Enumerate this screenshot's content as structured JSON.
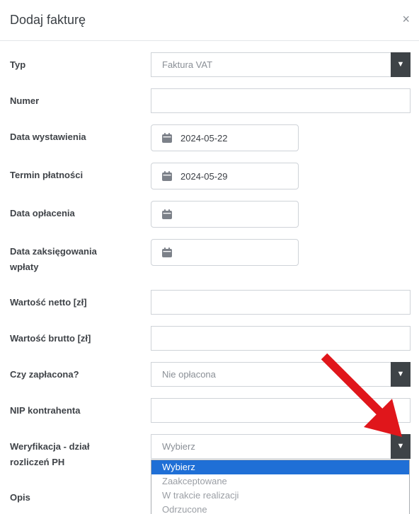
{
  "modal": {
    "title": "Dodaj fakturę",
    "close": "×"
  },
  "fields": {
    "typ": {
      "label": "Typ",
      "value": "Faktura VAT"
    },
    "numer": {
      "label": "Numer",
      "value": ""
    },
    "data_wystawienia": {
      "label": "Data wystawienia",
      "value": "2024-05-22"
    },
    "termin_platnosci": {
      "label": "Termin płatności",
      "value": "2024-05-29"
    },
    "data_oplacenia": {
      "label": "Data opłacenia",
      "value": ""
    },
    "data_zaksiegowania": {
      "label_line1": "Data zaksięgowania",
      "label_line2": "wpłaty",
      "value": ""
    },
    "wartosc_netto": {
      "label": "Wartość netto [zł]",
      "value": ""
    },
    "wartosc_brutto": {
      "label": "Wartość brutto [zł]",
      "value": ""
    },
    "czy_zaplacona": {
      "label": "Czy zapłacona?",
      "value": "Nie opłacona"
    },
    "nip": {
      "label": "NIP kontrahenta",
      "value": ""
    },
    "weryfikacja": {
      "label_line1": "Weryfikacja - dział",
      "label_line2": "rozliczeń PH",
      "value": "Wybierz"
    },
    "opis": {
      "label": "Opis"
    }
  },
  "dropdown": {
    "options": [
      "Wybierz",
      "Zaakceptowane",
      "W trakcie realizacji",
      "Odrzucone"
    ],
    "selected_index": 0,
    "selected_color": "#1f6fd6"
  },
  "colors": {
    "arrow": "#e0161b",
    "select_arrow_bg": "#3e4347"
  },
  "icons": {
    "select_arrow": "▼",
    "calendar": "calendar-icon"
  }
}
